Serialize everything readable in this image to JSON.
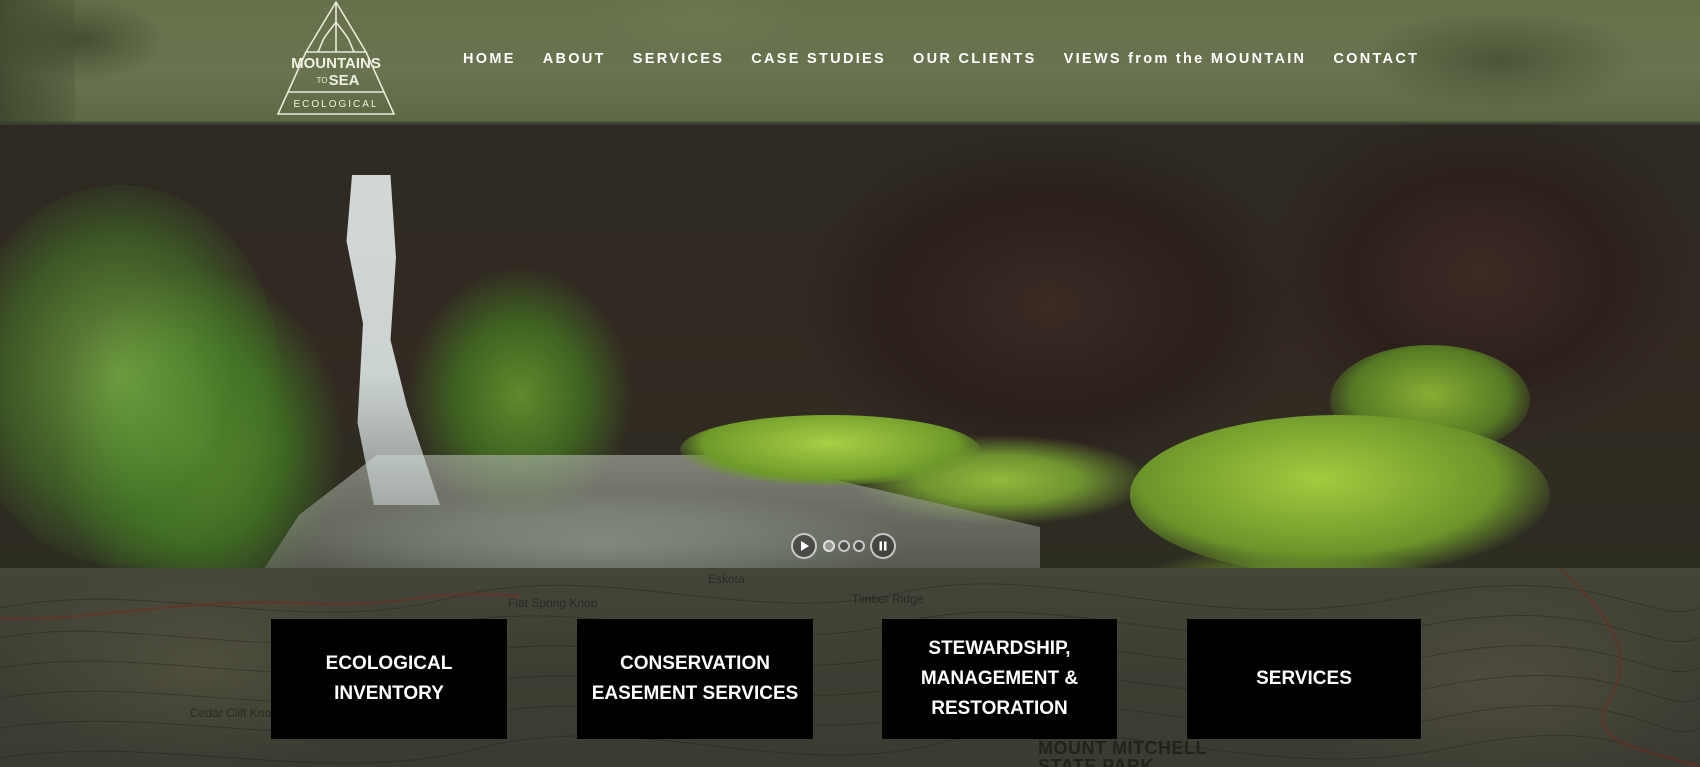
{
  "header": {
    "logo": {
      "line1": "MOUNTAINS",
      "line2": "TO",
      "line3": "SEA",
      "line4": "ECOLOGICAL"
    },
    "nav": [
      {
        "label": "HOME"
      },
      {
        "label": "ABOUT"
      },
      {
        "label": "SERVICES"
      },
      {
        "label": "CASE STUDIES"
      },
      {
        "label": "OUR CLIENTS"
      },
      {
        "label": "VIEWS from the MOUNTAIN"
      },
      {
        "label": "CONTACT"
      }
    ]
  },
  "hero": {
    "slider": {
      "play_icon": "play-icon",
      "pause_icon": "pause-icon",
      "slide_count": 3,
      "active_slide": 1
    }
  },
  "map": {
    "labels": [
      "Flat Spring Knob",
      "Eskota",
      "Timber Ridge",
      "Cedar Cliff Knob",
      "MOUNT MITCHELL",
      "STATE PARK"
    ]
  },
  "cards": [
    {
      "label": "ECOLOGICAL\nINVENTORY"
    },
    {
      "label": "CONSERVATION\nEASEMENT SERVICES"
    },
    {
      "label": "STEWARDSHIP,\nMANAGEMENT &\nRESTORATION"
    },
    {
      "label": "SERVICES"
    }
  ],
  "colors": {
    "header_bg": "#6a7350",
    "card_bg": "#000000",
    "nav_text": "#ffffff"
  }
}
